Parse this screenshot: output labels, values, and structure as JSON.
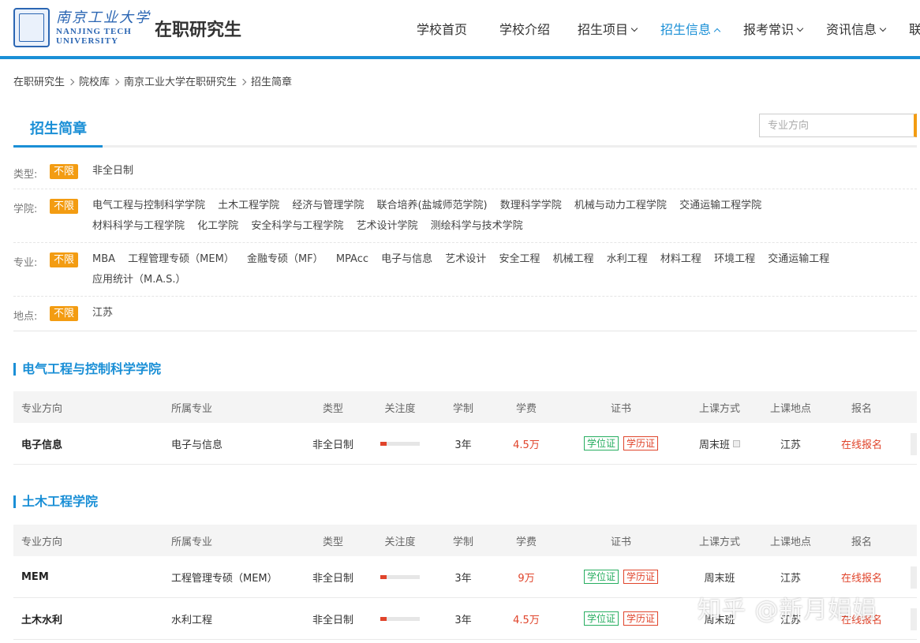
{
  "header": {
    "logo_cn": "南京工业大学",
    "logo_en_1": "NANJING TECH",
    "logo_en_2": "UNIVERSITY",
    "site_title": "在职研究生",
    "nav": [
      {
        "label": "学校首页"
      },
      {
        "label": "学校介绍"
      },
      {
        "label": "招生项目"
      },
      {
        "label": "招生信息"
      },
      {
        "label": "报考常识"
      },
      {
        "label": "资讯信息"
      },
      {
        "label": "联"
      }
    ]
  },
  "breadcrumb": [
    "在职研究生",
    "院校库",
    "南京工业大学在职研究生",
    "招生简章"
  ],
  "tab": {
    "label": "招生简章"
  },
  "search": {
    "placeholder": "专业方向"
  },
  "filters": [
    {
      "label": "类型:",
      "tag": "不限",
      "options": [
        "非全日制"
      ]
    },
    {
      "label": "学院:",
      "tag": "不限",
      "options": [
        "电气工程与控制科学学院",
        "土木工程学院",
        "经济与管理学院",
        "联合培养(盐城师范学院)",
        "数理科学学院",
        "机械与动力工程学院",
        "交通运输工程学院",
        "材料科学与工程学院",
        "化工学院",
        "安全科学与工程学院",
        "艺术设计学院",
        "测绘科学与技术学院"
      ]
    },
    {
      "label": "专业:",
      "tag": "不限",
      "options": [
        "MBA",
        "工程管理专硕（MEM）",
        "金融专硕（MF）",
        "MPAcc",
        "电子与信息",
        "艺术设计",
        "安全工程",
        "机械工程",
        "水利工程",
        "材料工程",
        "环境工程",
        "交通运输工程",
        "应用统计（M.A.S.）"
      ]
    },
    {
      "label": "地点:",
      "tag": "不限",
      "options": [
        "江苏"
      ]
    }
  ],
  "table_headers": [
    "专业方向",
    "所属专业",
    "类型",
    "关注度",
    "学制",
    "学费",
    "证书",
    "上课方式",
    "上课地点",
    "报名"
  ],
  "sections": [
    {
      "title": "电气工程与控制科学学院",
      "rows": [
        {
          "direction": "电子信息",
          "major": "电子与信息",
          "type": "非全日制",
          "heat": 0.15,
          "duration": "3年",
          "fee": "4.5万",
          "cert1": "学位证",
          "cert2": "学历证",
          "mode": "周末班",
          "location": "江苏",
          "signup": "在线报名"
        }
      ]
    },
    {
      "title": "土木工程学院",
      "rows": [
        {
          "direction": "MEM",
          "major": "工程管理专硕（MEM）",
          "type": "非全日制",
          "heat": 0.15,
          "duration": "3年",
          "fee": "9万",
          "cert1": "学位证",
          "cert2": "学历证",
          "mode": "周末班",
          "location": "江苏",
          "signup": "在线报名"
        },
        {
          "direction": "土木水利",
          "major": "水利工程",
          "type": "非全日制",
          "heat": 0.15,
          "duration": "3年",
          "fee": "4.5万",
          "cert1": "学位证",
          "cert2": "学历证",
          "mode": "周末班",
          "location": "江苏",
          "signup": "在线报名"
        }
      ]
    }
  ],
  "watermark": "知乎 @新月娟娟",
  "colors": {
    "accent": "#1a8fd6",
    "tag": "#f39c12",
    "fee": "#e0442b",
    "cert_green": "#27ae60"
  }
}
